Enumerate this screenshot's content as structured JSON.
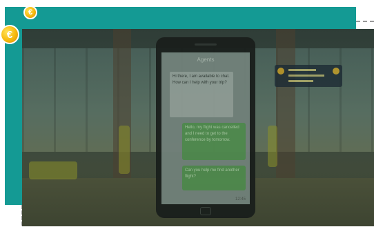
{
  "badges": {
    "small_icon": "coin-icon",
    "large_icon": "coin-icon",
    "symbol": "€"
  },
  "phone": {
    "header": "Agents",
    "incoming": "Hi there, I am available to chat. How can I help with your trip?",
    "outgoing_1": "Hello, my flight was cancelled and I need to get to the conference by tomorrow.",
    "outgoing_2": "Can you help me find another flight?",
    "time": "12:45"
  },
  "colors": {
    "teal": "#149a94",
    "coin": "#f7b90d",
    "bubble_green": "#4f8a4e"
  }
}
